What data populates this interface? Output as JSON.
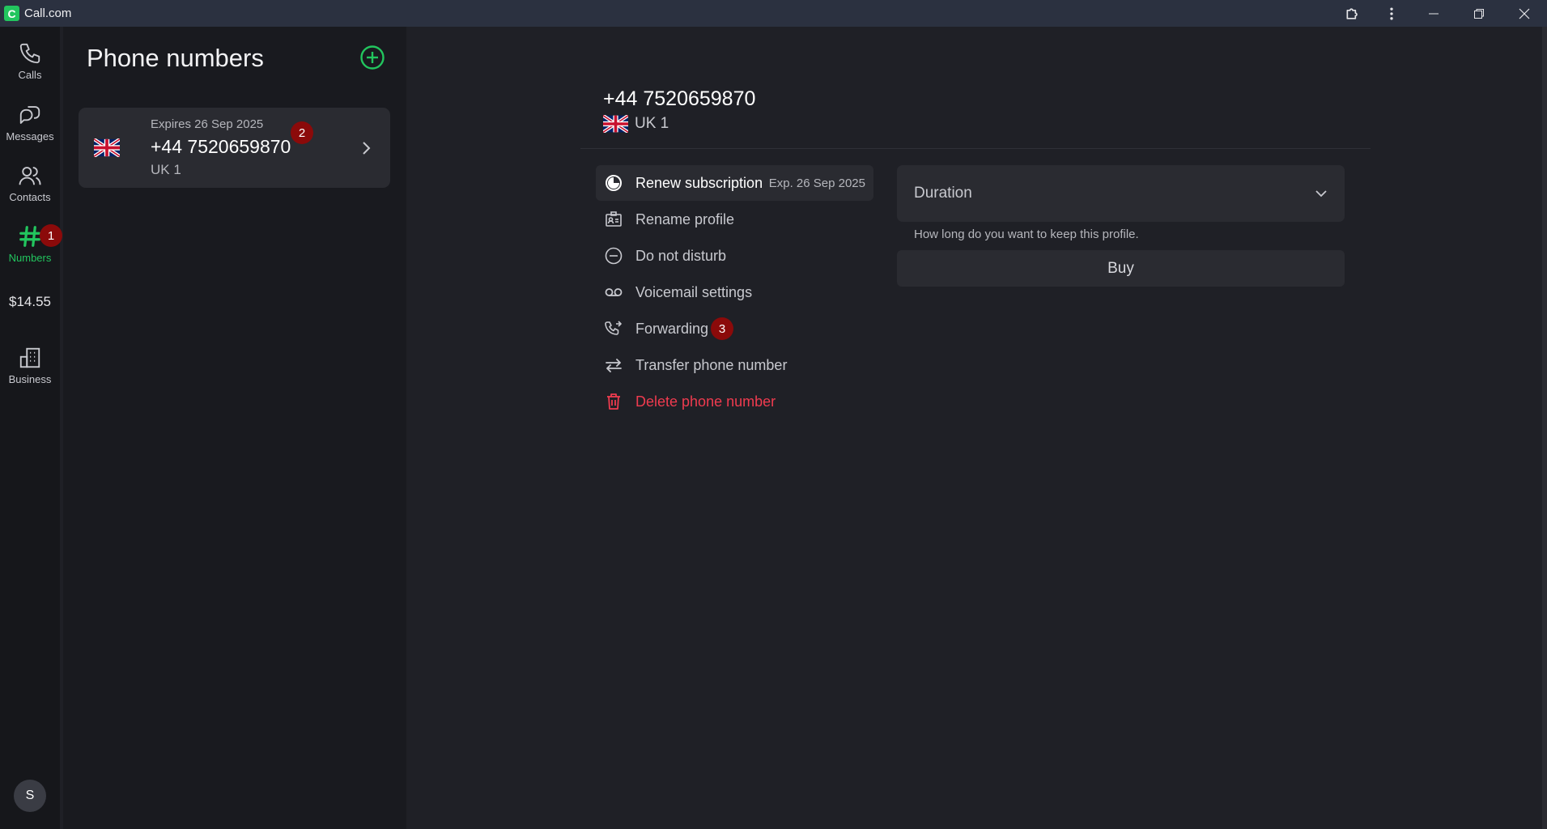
{
  "window": {
    "title": "Call.com",
    "logo_letter": "C"
  },
  "rail": {
    "items": [
      {
        "label": "Calls",
        "icon": "phone-icon"
      },
      {
        "label": "Messages",
        "icon": "chat-bubbles-icon"
      },
      {
        "label": "Contacts",
        "icon": "contacts-icon"
      },
      {
        "label": "Numbers",
        "icon": "hash-icon",
        "active": true
      },
      {
        "label": "Business",
        "icon": "building-icon"
      }
    ],
    "numbers_badge": "1",
    "balance": "$14.55",
    "avatar_initial": "S"
  },
  "panel": {
    "title": "Phone numbers",
    "card": {
      "expires": "Expires 26 Sep 2025",
      "number": "+44 7520659870",
      "name": "UK 1",
      "badge": "2"
    }
  },
  "detail": {
    "number": "+44 7520659870",
    "name": "UK 1",
    "menu": [
      {
        "label": "Renew subscription",
        "sub": "Exp. 26 Sep 2025",
        "icon": "renew-icon"
      },
      {
        "label": "Rename profile",
        "icon": "id-card-icon"
      },
      {
        "label": "Do not disturb",
        "icon": "minus-circle-icon"
      },
      {
        "label": "Voicemail settings",
        "icon": "voicemail-icon"
      },
      {
        "label": "Forwarding",
        "icon": "phone-forward-icon",
        "badge": "3"
      },
      {
        "label": "Transfer phone number",
        "icon": "transfer-arrows-icon"
      },
      {
        "label": "Delete phone number",
        "icon": "trash-icon"
      }
    ],
    "duration": {
      "label": "Duration",
      "help": "How long do you want to keep this profile."
    },
    "buy_label": "Buy"
  },
  "colors": {
    "accent": "#22c55e",
    "badge": "#8b0a0a",
    "danger": "#ef3b4f",
    "titlebar": "#2b3140"
  }
}
